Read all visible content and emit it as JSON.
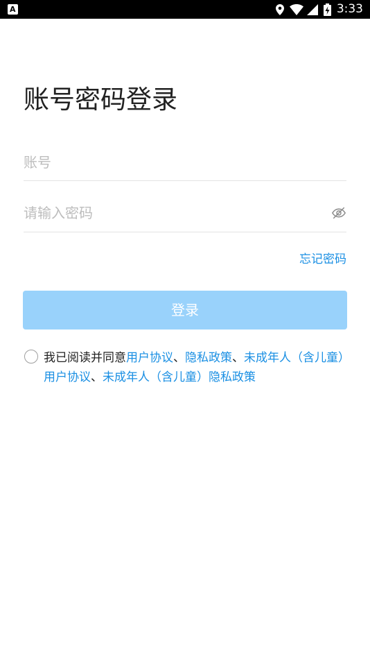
{
  "status_bar": {
    "app_icon_letter": "A",
    "time": "3:33",
    "icons": [
      "location-icon",
      "wifi-icon",
      "signal-icon",
      "battery-charging-icon"
    ]
  },
  "title": "账号密码登录",
  "account_field": {
    "placeholder": "账号",
    "value": ""
  },
  "password_field": {
    "placeholder": "请输入密码",
    "value": "",
    "visibility_icon": "eye-off-icon"
  },
  "forgot_password": "忘记密码",
  "login_button": "登录",
  "agreement": {
    "checked": false,
    "prefix": "我已阅读并同意",
    "links": [
      {
        "text": "用户协议"
      },
      {
        "text": "隐私政策"
      },
      {
        "text": "未成年人（含儿童）用户协议"
      },
      {
        "text": "未成年人（含儿童）隐私政策"
      }
    ],
    "separator": "、"
  },
  "colors": {
    "link": "#1a8fe3",
    "button_disabled": "#99d2fb",
    "title": "#222222",
    "placeholder": "#bdbdbd"
  }
}
